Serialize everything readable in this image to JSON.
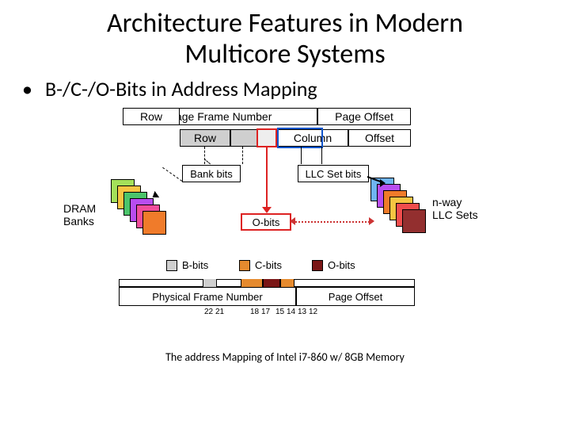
{
  "title_line1": "Architecture Features in Modern",
  "title_line2": "Multicore Systems",
  "bullet": "B-/C-/O-Bits in Address Mapping",
  "top_row": {
    "pfn": "Page Frame Number",
    "page_offset": "Page Offset",
    "row1": "Row",
    "row2": "Row",
    "column": "Column",
    "offset": "Offset"
  },
  "mid": {
    "bank_bits": "Bank bits",
    "llc_set_bits": "LLC Set bits",
    "o_bits": "O-bits",
    "dram_banks_line1": "DRAM",
    "dram_banks_line2": "Banks",
    "nway_line1": "n-way",
    "nway_line2": "LLC Sets"
  },
  "legend": {
    "b": "B-bits",
    "c": "C-bits",
    "o": "O-bits"
  },
  "bottom_bar": {
    "pfn": "Physical Frame Number",
    "po": "Page Offset",
    "t22": "22",
    "t21": "21",
    "t18": "18",
    "t17": "17",
    "t15": "15",
    "t14": "14",
    "t13": "13",
    "t12": "12"
  },
  "caption": "The address Mapping of Intel i7-860 w/ 8GB Memory"
}
